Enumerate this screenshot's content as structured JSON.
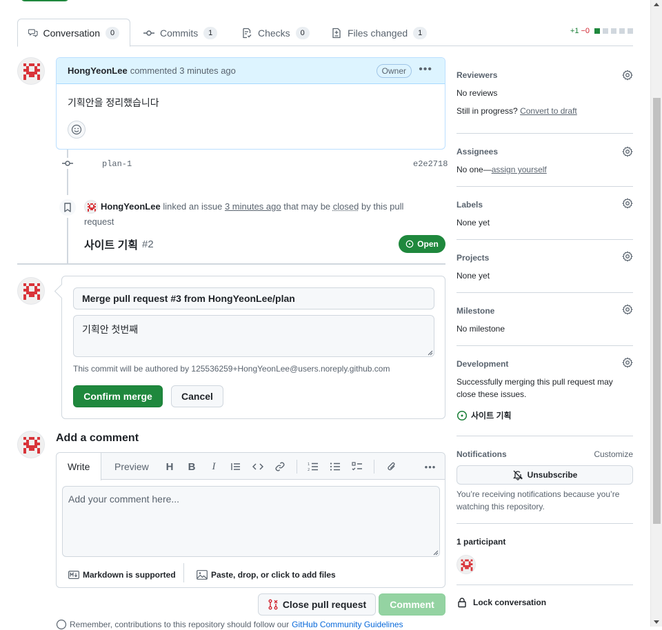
{
  "tabs": [
    {
      "label": "Conversation",
      "count": "0"
    },
    {
      "label": "Commits",
      "count": "1"
    },
    {
      "label": "Checks",
      "count": "0"
    },
    {
      "label": "Files changed",
      "count": "1"
    }
  ],
  "diffstat": {
    "added": "+1",
    "removed": "−0"
  },
  "comment": {
    "author": "HongYeonLee",
    "action": "commented",
    "time": "3 minutes ago",
    "badge": "Owner",
    "body": "기획안을 정리했습니다"
  },
  "commit": {
    "message": "plan-1",
    "sha": "e2e2718"
  },
  "linked_event": {
    "author": "HongYeonLee",
    "text1": "linked an issue",
    "time": "3 minutes ago",
    "text2": "that may be",
    "closed": "closed",
    "text3": "by this pull request",
    "issue_title": "사이트 기획",
    "issue_number": "#2",
    "status": "Open"
  },
  "merge": {
    "title_value": "Merge pull request #3 from HongYeonLee/plan",
    "body_value": "기획안 첫번째",
    "note": "This commit will be authored by 125536259+HongYeonLee@users.noreply.github.com",
    "confirm_label": "Confirm merge",
    "cancel_label": "Cancel"
  },
  "add_comment": {
    "title": "Add a comment",
    "write_tab": "Write",
    "preview_tab": "Preview",
    "placeholder": "Add your comment here...",
    "markdown_note": "Markdown is supported",
    "attach_note": "Paste, drop, or click to add files",
    "close_label": "Close pull request",
    "comment_label": "Comment",
    "bottom_note_prefix": "Remember, contributions to this repository should follow our",
    "bottom_note_link": "GitHub Community Guidelines"
  },
  "sidebar": {
    "reviewers": {
      "title": "Reviewers",
      "line1": "No reviews",
      "line2_prefix": "Still in progress?",
      "line2_link": "Convert to draft"
    },
    "assignees": {
      "title": "Assignees",
      "prefix": "No one—",
      "link": "assign yourself"
    },
    "labels": {
      "title": "Labels",
      "value": "None yet"
    },
    "projects": {
      "title": "Projects",
      "value": "None yet"
    },
    "milestone": {
      "title": "Milestone",
      "value": "No milestone"
    },
    "development": {
      "title": "Development",
      "text": "Successfully merging this pull request may close these issues.",
      "issue": "사이트 기획"
    },
    "notifications": {
      "title": "Notifications",
      "customize": "Customize",
      "button": "Unsubscribe",
      "note": "You’re receiving notifications because you’re watching this repository."
    },
    "participants": {
      "title": "1 participant"
    },
    "lock": {
      "label": "Lock conversation"
    }
  },
  "colors": {
    "accent_green": "#1f883d",
    "link_blue": "#0969da",
    "header_blue": "#ddf4ff"
  }
}
